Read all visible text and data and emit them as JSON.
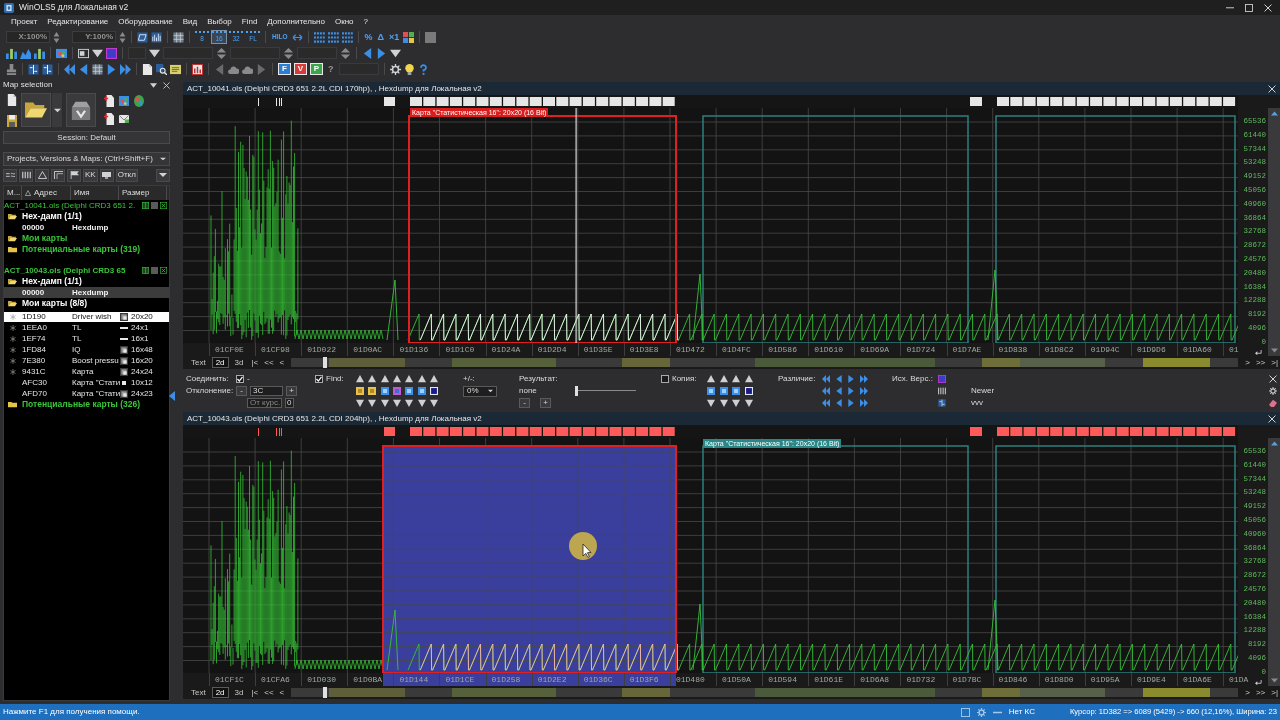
{
  "window": {
    "title": "WinOLS5 для Локальная v2"
  },
  "menu": [
    "Проект",
    "Редактирование",
    "Оборудование",
    "Вид",
    "Выбор",
    "Find",
    "Дополнительно",
    "Окно",
    "?"
  ],
  "toolbar": {
    "zoom_x": {
      "value": "X:100%",
      "disabled": true
    },
    "zoom_y": {
      "value": "Y:100%",
      "disabled": true
    },
    "bit_widths": [
      {
        "label": "8",
        "selected": false
      },
      {
        "label": "16",
        "selected": true
      },
      {
        "label": "32",
        "selected": false
      },
      {
        "label": "FL",
        "selected": false
      }
    ],
    "text_buttons": [
      "HILO",
      "%",
      "Δ",
      "×1"
    ],
    "version_tiles": [
      {
        "label": "F",
        "color": "#2a7fd4"
      },
      {
        "label": "V",
        "color": "#d83a3a"
      },
      {
        "label": "P",
        "color": "#3aa64a"
      }
    ],
    "help_mark": {
      "label": "?",
      "disabled": true
    }
  },
  "sidebar": {
    "title": "Map selection",
    "session_button": "Session: Default",
    "filter_dropdown": "Projects, Versions & Maps:  (Ctrl+Shift+F)",
    "filter_buttons": [
      "KK",
      "Откл"
    ],
    "columns": [
      {
        "label": "М...",
        "sorted": false
      },
      {
        "label": "Адрес",
        "sorted": true
      },
      {
        "label": "Имя",
        "sorted": false
      },
      {
        "label": "Размер",
        "sorted": false
      }
    ],
    "tree": [
      {
        "kind": "project",
        "label": "ACT_10041.ols (Delphi CRD3 651 2.",
        "active": false,
        "children": [
          {
            "kind": "folder",
            "label": "Hex-дамп (1/1)",
            "expanded": true,
            "color": "#ffffff",
            "children": [
              {
                "kind": "hexdump",
                "address": "00000",
                "name": "Hexdump",
                "highlighted": false
              }
            ]
          },
          {
            "kind": "folder",
            "label": "Мои карты",
            "expanded": true,
            "color": "#39c739"
          },
          {
            "kind": "folder",
            "label": "Потенциальные карты (319)",
            "expanded": false,
            "color": "#39c739"
          }
        ]
      },
      {
        "kind": "project",
        "label": "ACT_10043.ols (Delphi CRD3 65",
        "active": true,
        "children": [
          {
            "kind": "folder",
            "label": "Hex-дамп (1/1)",
            "expanded": true,
            "color": "#ffffff",
            "children": [
              {
                "kind": "hexdump",
                "address": "00000",
                "name": "Hexdump",
                "highlighted": true
              }
            ]
          },
          {
            "kind": "folder",
            "label": "Мои карты (8/8)",
            "expanded": true,
            "color": "#ffffff",
            "children": [
              {
                "kind": "map",
                "marked": true,
                "address": "1D190",
                "name": "Driver wish",
                "preview": {
                  "kind": "block"
                },
                "size": "20x20",
                "selected": true
              },
              {
                "kind": "map",
                "marked": true,
                "address": "1EEA0",
                "name": "TL",
                "preview": {
                  "kind": "line"
                },
                "size": "24x1",
                "selected": false
              },
              {
                "kind": "map",
                "marked": true,
                "address": "1EF74",
                "name": "TL",
                "preview": {
                  "kind": "line"
                },
                "size": "16x1",
                "selected": false
              },
              {
                "kind": "map",
                "marked": true,
                "address": "1FD84",
                "name": "IQ",
                "preview": {
                  "kind": "block"
                },
                "size": "16x48",
                "selected": false
              },
              {
                "kind": "map",
                "marked": true,
                "address": "7E380",
                "name": "Boost pressu",
                "preview": {
                  "kind": "block"
                },
                "size": "16x20",
                "selected": false
              },
              {
                "kind": "map",
                "marked": true,
                "address": "9431C",
                "name": "Карта",
                "preview": {
                  "kind": "block"
                },
                "size": "24x24",
                "selected": false
              },
              {
                "kind": "map",
                "marked": false,
                "address": "AFC30",
                "name": "Карта \"Стати",
                "preview": {
                  "kind": "dot"
                },
                "size": "10x12",
                "selected": false
              },
              {
                "kind": "map",
                "marked": false,
                "address": "AFD70",
                "name": "Карта \"Стати",
                "preview": {
                  "kind": "block"
                },
                "size": "24x23",
                "selected": false
              }
            ]
          },
          {
            "kind": "folder",
            "label": "Потенциальные карты (326)",
            "expanded": false,
            "color": "#39c739"
          }
        ]
      }
    ]
  },
  "panes": [
    {
      "kind": "original",
      "title": "ACT_10041.ols (Delphi CRD3 651 2.2L CDI 170hp), , Hexdump для Локальная v2",
      "map_label": "Карта \"Статистическая 16\": 20x20 (16 Bit)",
      "cursor_line": true,
      "pointer": false,
      "x_labels": [
        "01CF0E",
        "01CF98",
        "01D022",
        "01D0AC",
        "01D136",
        "01D1C0",
        "01D24A",
        "01D2D4",
        "01D35E",
        "01D3E8",
        "01D472",
        "01D4FC",
        "01D586",
        "01D610",
        "01D69A",
        "01D724",
        "01D7AE",
        "01D838",
        "01D8C2",
        "01D94C",
        "01D9D6",
        "01DA60",
        "01"
      ],
      "y_labels": [
        "65536",
        "61440",
        "57344",
        "53248",
        "49152",
        "45056",
        "40960",
        "36864",
        "32768",
        "28672",
        "24576",
        "20480",
        "16384",
        "12288",
        "8192",
        "4096",
        "0"
      ],
      "view_tabs": [
        {
          "label": "Text",
          "selected": false
        },
        {
          "label": "2d",
          "selected": true
        },
        {
          "label": "3d",
          "selected": false
        }
      ],
      "nav_back": [
        "|<",
        "<<",
        "<"
      ],
      "nav_forward": [
        ">",
        ">>",
        ">|"
      ]
    },
    {
      "kind": "compare",
      "title": "ACT_10043.ols (Delphi CRD3 651 2.2L CDI 204hp), , Hexdump для Локальная v2",
      "map_label": "Карта \"Статистическая 16\": 20x20 (16 Bit)",
      "cursor_line": false,
      "pointer": true,
      "x_labels": [
        "01CF1C",
        "01CFA6",
        "01D030",
        "01D0BA",
        "01D144",
        "01D1CE",
        "01D258",
        "01D2E2",
        "01D36C",
        "01D3F6",
        "01D480",
        "01D50A",
        "01D594",
        "01D61E",
        "01D6A8",
        "01D732",
        "01D7BC",
        "01D846",
        "01D8D0",
        "01D95A",
        "01D9E4",
        "01DA6E",
        "01DA"
      ],
      "y_labels": [
        "65536",
        "61440",
        "57344",
        "53248",
        "49152",
        "45056",
        "40960",
        "36864",
        "32768",
        "28672",
        "24576",
        "20480",
        "16384",
        "12288",
        "8192",
        "4096",
        "0"
      ],
      "view_tabs": [
        {
          "label": "Text",
          "selected": false
        },
        {
          "label": "2d",
          "selected": true
        },
        {
          "label": "3d",
          "selected": false
        }
      ],
      "nav_back": [
        "|<",
        "<<",
        "<"
      ],
      "nav_forward": [
        ">",
        ">>",
        ">|"
      ]
    }
  ],
  "compare_bar": {
    "connect": {
      "label": "Соединить:",
      "checked": true,
      "suffix": "-"
    },
    "deviation": {
      "label": "Отклонение:",
      "minus": "-",
      "value": "3C",
      "plus": "+"
    },
    "from_cursor": {
      "placeholder": "От курс."
    },
    "cursor_offset": {
      "value": "0"
    },
    "find": {
      "label": "Find:",
      "checked": true
    },
    "tolerance": {
      "label": "+/-:",
      "value": "0%"
    },
    "result": {
      "label": "Результат:",
      "value": "none",
      "minus": "-",
      "plus": "+",
      "level": 0
    },
    "copy": {
      "label": "Копия:",
      "checked": false
    },
    "difference": {
      "label": "Различие:"
    },
    "source_version": {
      "label": "Исх. Верс.:"
    },
    "newer": {
      "label": "Newer",
      "value": "vvv"
    }
  },
  "status_bar": {
    "help": "Нажмите F1 для получения помощи.",
    "checksum": "Нет КС",
    "cursor": "Курсор: 1D382 => 6089 (5429) -> 660 (12,16%), Ширина: 23"
  }
}
